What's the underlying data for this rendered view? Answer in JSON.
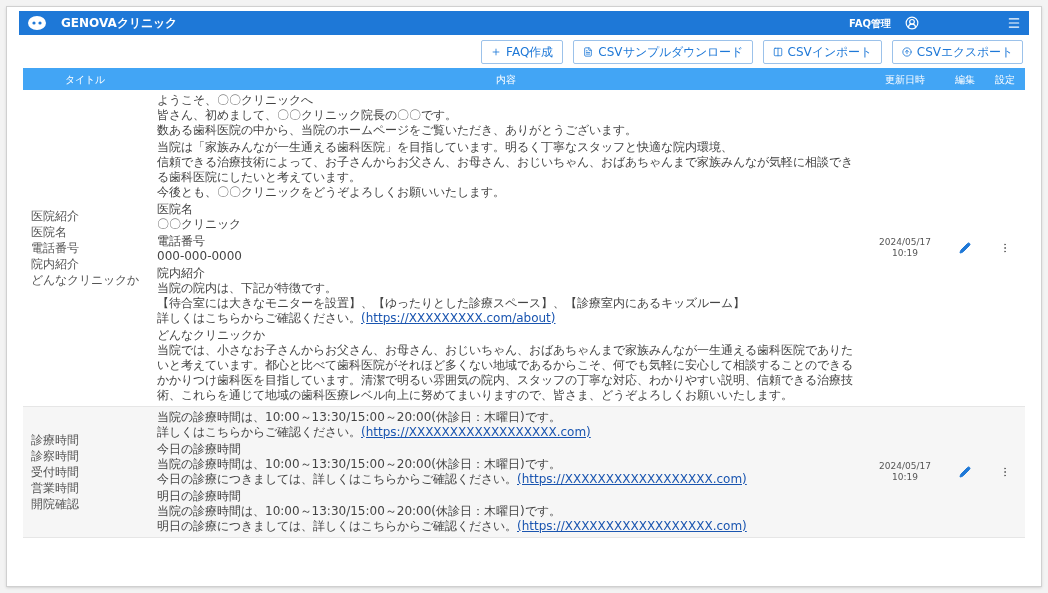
{
  "app_bar": {
    "title": "GENOVAクリニック",
    "menu_label": "FAQ管理"
  },
  "toolbar": [
    {
      "label": "FAQ作成",
      "kind": "plus"
    },
    {
      "label": "CSVサンプルダウンロード",
      "kind": "file"
    },
    {
      "label": "CSVインポート",
      "kind": "import"
    },
    {
      "label": "CSVエクスポート",
      "kind": "export"
    }
  ],
  "table": {
    "columns": [
      "タイトル",
      "内容",
      "更新日時",
      "編集",
      "設定"
    ],
    "rows": [
      {
        "titles": [
          "医院紹介",
          "医院名",
          "電話番号",
          "院内紹介",
          "どんなクリニックか"
        ],
        "updated": [
          "2024/05/17",
          "10:19"
        ],
        "blocks": [
          [
            {
              "text": "ようこそ、〇〇クリニックへ"
            },
            {
              "text": "皆さん、初めまして、〇〇クリニック院長の〇〇です。"
            },
            {
              "text": "数ある歯科医院の中から、当院のホームページをご覧いただき、ありがとうございます。"
            }
          ],
          [
            {
              "text": "当院は「家族みんなが一生通える歯科医院」を目指しています。明るく丁寧なスタッフと快適な院内環境、"
            },
            {
              "text": "信頼できる治療技術によって、お子さんからお父さん、お母さん、おじいちゃん、おばあちゃんまで家族みんなが気軽に相談できる歯科医院にしたいと考えています。"
            },
            {
              "text": "今後とも、〇〇クリニックをどうぞよろしくお願いいたします。"
            }
          ],
          [
            {
              "text": "医院名"
            },
            {
              "text": "〇〇クリニック"
            }
          ],
          [
            {
              "text": "電話番号"
            },
            {
              "text": "000-000-0000"
            }
          ],
          [
            {
              "text": "院内紹介"
            },
            {
              "text": "当院の院内は、下記が特徴です。"
            },
            {
              "text": "【待合室には大きなモニターを設置】、【ゆったりとした診療スペース】、【診療室内にあるキッズルーム】"
            },
            {
              "text": "詳しくはこちらからご確認ください。",
              "link": "(https://XXXXXXXXX.com/about)"
            }
          ],
          [
            {
              "text": "どんなクリニックか"
            },
            {
              "text": "当院では、小さなお子さんからお父さん、お母さん、おじいちゃん、おばあちゃんまで家族みんなが一生通える歯科医院でありたいと考えています。都心と比べて歯科医院がそれほど多くない地域であるからこそ、何でも気軽に安心して相談することのできるかかりつけ歯科医を目指しています。清潔で明るい雰囲気の院内、スタッフの丁寧な対応、わかりやすい説明、信頼できる治療技術、これらを通じて地域の歯科医療レベル向上に努めてまいりますので、皆さま、どうぞよろしくお願いいたします。"
            }
          ]
        ]
      },
      {
        "titles": [
          "診療時間",
          "診察時間",
          "受付時間",
          "営業時間",
          "開院確認"
        ],
        "updated": [
          "2024/05/17",
          "10:19"
        ],
        "blocks": [
          [
            {
              "text": "当院の診療時間は、10:00～13:30/15:00～20:00(休診日：木曜日)です。"
            },
            {
              "text": "詳しくはこちらからご確認ください。",
              "link": "(https://XXXXXXXXXXXXXXXXXX.com)"
            }
          ],
          [
            {
              "text": "今日の診療時間"
            },
            {
              "text": "当院の診療時間は、10:00～13:30/15:00～20:00(休診日：木曜日)です。"
            },
            {
              "text": "今日の診療につきましては、詳しくはこちらからご確認ください。",
              "link": "(https://XXXXXXXXXXXXXXXXXX.com)"
            }
          ],
          [
            {
              "text": "明日の診療時間"
            },
            {
              "text": "当院の診療時間は、10:00～13:30/15:00～20:00(休診日：木曜日)です。"
            },
            {
              "text": "明日の診療につきましては、詳しくはこちらからご確認ください。",
              "link": "(https://XXXXXXXXXXXXXXXXXX.com)"
            }
          ]
        ]
      }
    ]
  }
}
